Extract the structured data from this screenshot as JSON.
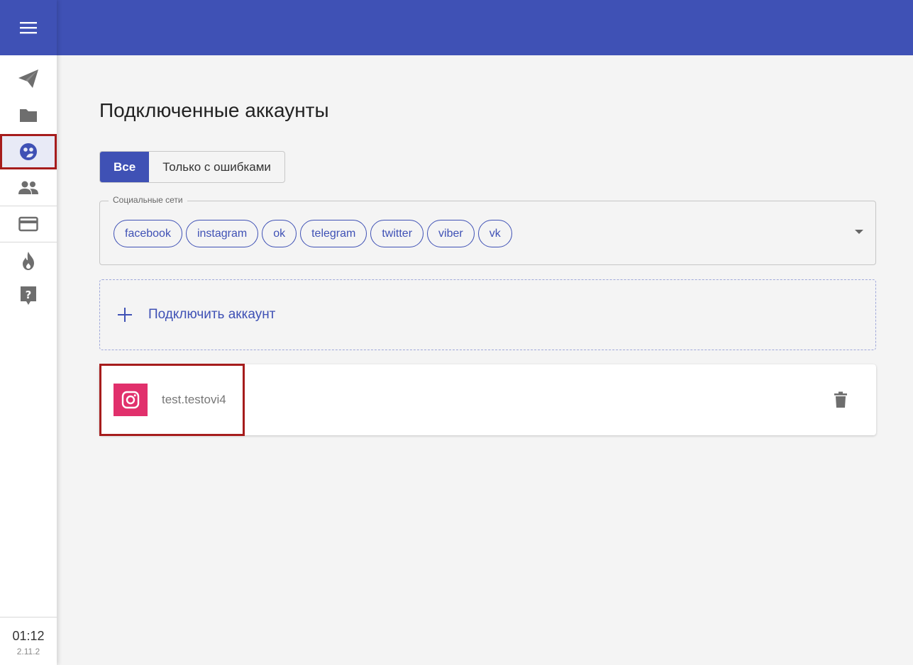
{
  "sidebar": {
    "menu_icon": "hamburger-menu-icon",
    "items": [
      {
        "name": "send",
        "icon": "paper-plane-icon"
      },
      {
        "name": "folder",
        "icon": "folder-icon"
      },
      {
        "name": "accounts",
        "icon": "social-accounts-icon",
        "active": true
      },
      {
        "name": "people",
        "icon": "people-icon"
      },
      {
        "name": "billing",
        "icon": "credit-card-icon"
      },
      {
        "name": "hot",
        "icon": "fire-icon"
      },
      {
        "name": "help",
        "icon": "help-icon"
      }
    ],
    "clock": "01:12",
    "version": "2.11.2"
  },
  "main": {
    "title": "Подключенные аккаунты",
    "filter": {
      "all_label": "Все",
      "errors_label": "Только с ошибками",
      "selected": "all"
    },
    "social": {
      "legend": "Социальные сети",
      "chips": [
        "facebook",
        "instagram",
        "ok",
        "telegram",
        "twitter",
        "viber",
        "vk"
      ]
    },
    "connect_label": "Подключить аккаунт",
    "accounts": [
      {
        "network": "instagram",
        "name": "test.testovi4"
      }
    ]
  },
  "colors": {
    "primary": "#3f51b5",
    "instagram": "#e1306c",
    "highlight": "#a61c1c"
  }
}
